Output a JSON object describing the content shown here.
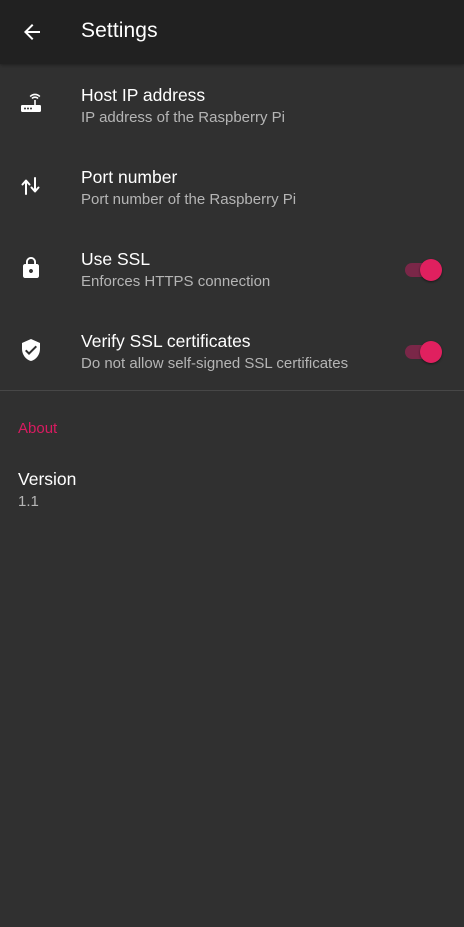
{
  "toolbar": {
    "back_icon": "arrow-back-icon",
    "title": "Settings"
  },
  "preferences": [
    {
      "icon": "router-icon",
      "title": "Host IP address",
      "summary": "IP address of the Raspberry Pi"
    },
    {
      "icon": "swap-vertical-icon",
      "title": "Port number",
      "summary": "Port number of the Raspberry Pi"
    },
    {
      "icon": "lock-icon",
      "title": "Use SSL",
      "summary": "Enforces HTTPS connection",
      "switch_on": true
    },
    {
      "icon": "verified-shield-icon",
      "title": "Verify SSL certificates",
      "summary": "Do not allow self-signed SSL certificates",
      "switch_on": true
    }
  ],
  "about": {
    "header": "About",
    "version_title": "Version",
    "version_value": "1.1"
  },
  "colors": {
    "background": "#303030",
    "toolbar": "#212121",
    "accent": "#e0205f",
    "section_header": "#d81b60"
  }
}
